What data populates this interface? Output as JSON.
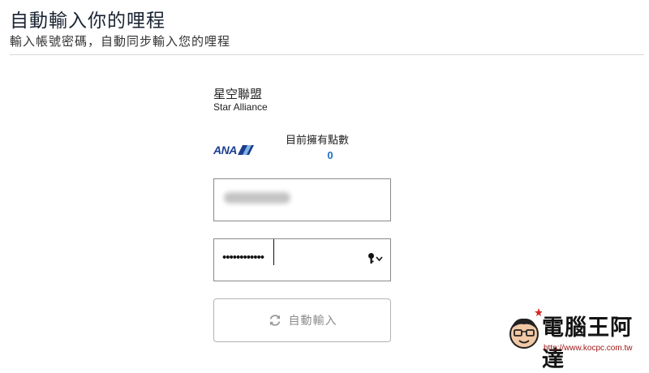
{
  "header": {
    "title": "自動輸入你的哩程",
    "subtitle": "輸入帳號密碼，自動同步輸入您的哩程"
  },
  "alliance": {
    "name": "星空聯盟",
    "name_en": "Star Alliance"
  },
  "airline": {
    "logo_text": "ANA",
    "points_label": "目前擁有點數",
    "points_value": "0",
    "brand_color": "#1b3e8f",
    "points_color": "#1f6fc4"
  },
  "form": {
    "account_value": "",
    "password_value": "••••••••••••",
    "password_icon": "key-icon",
    "submit_label": "自動輸入",
    "submit_icon": "sync-icon"
  },
  "watermark": {
    "title": "電腦王阿達",
    "url": "http://www.kocpc.com.tw"
  }
}
